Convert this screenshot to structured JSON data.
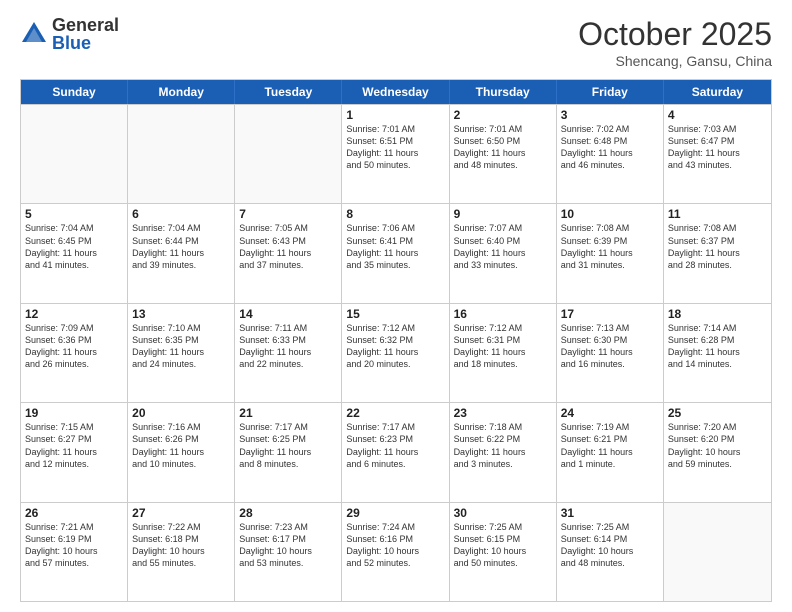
{
  "header": {
    "logo_general": "General",
    "logo_blue": "Blue",
    "month_title": "October 2025",
    "location": "Shencang, Gansu, China"
  },
  "days_of_week": [
    "Sunday",
    "Monday",
    "Tuesday",
    "Wednesday",
    "Thursday",
    "Friday",
    "Saturday"
  ],
  "weeks": [
    [
      {
        "day": "",
        "info": ""
      },
      {
        "day": "",
        "info": ""
      },
      {
        "day": "",
        "info": ""
      },
      {
        "day": "1",
        "info": "Sunrise: 7:01 AM\nSunset: 6:51 PM\nDaylight: 11 hours\nand 50 minutes."
      },
      {
        "day": "2",
        "info": "Sunrise: 7:01 AM\nSunset: 6:50 PM\nDaylight: 11 hours\nand 48 minutes."
      },
      {
        "day": "3",
        "info": "Sunrise: 7:02 AM\nSunset: 6:48 PM\nDaylight: 11 hours\nand 46 minutes."
      },
      {
        "day": "4",
        "info": "Sunrise: 7:03 AM\nSunset: 6:47 PM\nDaylight: 11 hours\nand 43 minutes."
      }
    ],
    [
      {
        "day": "5",
        "info": "Sunrise: 7:04 AM\nSunset: 6:45 PM\nDaylight: 11 hours\nand 41 minutes."
      },
      {
        "day": "6",
        "info": "Sunrise: 7:04 AM\nSunset: 6:44 PM\nDaylight: 11 hours\nand 39 minutes."
      },
      {
        "day": "7",
        "info": "Sunrise: 7:05 AM\nSunset: 6:43 PM\nDaylight: 11 hours\nand 37 minutes."
      },
      {
        "day": "8",
        "info": "Sunrise: 7:06 AM\nSunset: 6:41 PM\nDaylight: 11 hours\nand 35 minutes."
      },
      {
        "day": "9",
        "info": "Sunrise: 7:07 AM\nSunset: 6:40 PM\nDaylight: 11 hours\nand 33 minutes."
      },
      {
        "day": "10",
        "info": "Sunrise: 7:08 AM\nSunset: 6:39 PM\nDaylight: 11 hours\nand 31 minutes."
      },
      {
        "day": "11",
        "info": "Sunrise: 7:08 AM\nSunset: 6:37 PM\nDaylight: 11 hours\nand 28 minutes."
      }
    ],
    [
      {
        "day": "12",
        "info": "Sunrise: 7:09 AM\nSunset: 6:36 PM\nDaylight: 11 hours\nand 26 minutes."
      },
      {
        "day": "13",
        "info": "Sunrise: 7:10 AM\nSunset: 6:35 PM\nDaylight: 11 hours\nand 24 minutes."
      },
      {
        "day": "14",
        "info": "Sunrise: 7:11 AM\nSunset: 6:33 PM\nDaylight: 11 hours\nand 22 minutes."
      },
      {
        "day": "15",
        "info": "Sunrise: 7:12 AM\nSunset: 6:32 PM\nDaylight: 11 hours\nand 20 minutes."
      },
      {
        "day": "16",
        "info": "Sunrise: 7:12 AM\nSunset: 6:31 PM\nDaylight: 11 hours\nand 18 minutes."
      },
      {
        "day": "17",
        "info": "Sunrise: 7:13 AM\nSunset: 6:30 PM\nDaylight: 11 hours\nand 16 minutes."
      },
      {
        "day": "18",
        "info": "Sunrise: 7:14 AM\nSunset: 6:28 PM\nDaylight: 11 hours\nand 14 minutes."
      }
    ],
    [
      {
        "day": "19",
        "info": "Sunrise: 7:15 AM\nSunset: 6:27 PM\nDaylight: 11 hours\nand 12 minutes."
      },
      {
        "day": "20",
        "info": "Sunrise: 7:16 AM\nSunset: 6:26 PM\nDaylight: 11 hours\nand 10 minutes."
      },
      {
        "day": "21",
        "info": "Sunrise: 7:17 AM\nSunset: 6:25 PM\nDaylight: 11 hours\nand 8 minutes."
      },
      {
        "day": "22",
        "info": "Sunrise: 7:17 AM\nSunset: 6:23 PM\nDaylight: 11 hours\nand 6 minutes."
      },
      {
        "day": "23",
        "info": "Sunrise: 7:18 AM\nSunset: 6:22 PM\nDaylight: 11 hours\nand 3 minutes."
      },
      {
        "day": "24",
        "info": "Sunrise: 7:19 AM\nSunset: 6:21 PM\nDaylight: 11 hours\nand 1 minute."
      },
      {
        "day": "25",
        "info": "Sunrise: 7:20 AM\nSunset: 6:20 PM\nDaylight: 10 hours\nand 59 minutes."
      }
    ],
    [
      {
        "day": "26",
        "info": "Sunrise: 7:21 AM\nSunset: 6:19 PM\nDaylight: 10 hours\nand 57 minutes."
      },
      {
        "day": "27",
        "info": "Sunrise: 7:22 AM\nSunset: 6:18 PM\nDaylight: 10 hours\nand 55 minutes."
      },
      {
        "day": "28",
        "info": "Sunrise: 7:23 AM\nSunset: 6:17 PM\nDaylight: 10 hours\nand 53 minutes."
      },
      {
        "day": "29",
        "info": "Sunrise: 7:24 AM\nSunset: 6:16 PM\nDaylight: 10 hours\nand 52 minutes."
      },
      {
        "day": "30",
        "info": "Sunrise: 7:25 AM\nSunset: 6:15 PM\nDaylight: 10 hours\nand 50 minutes."
      },
      {
        "day": "31",
        "info": "Sunrise: 7:25 AM\nSunset: 6:14 PM\nDaylight: 10 hours\nand 48 minutes."
      },
      {
        "day": "",
        "info": ""
      }
    ]
  ]
}
